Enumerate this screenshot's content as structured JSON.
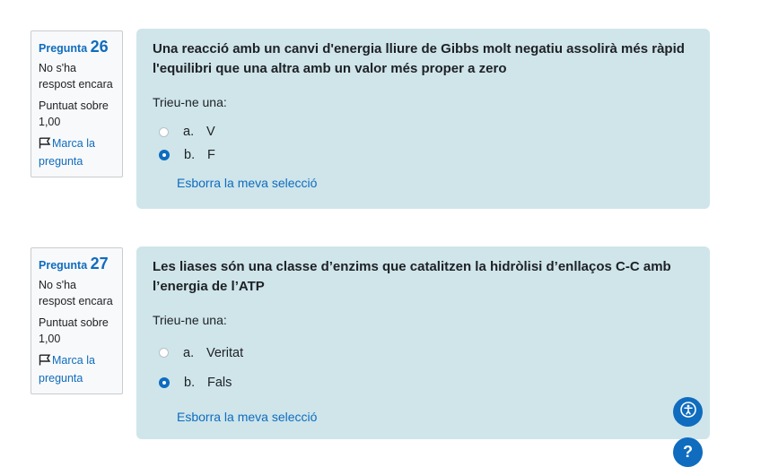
{
  "questions": [
    {
      "label": "Pregunta",
      "number": "26",
      "state": "No s'ha respost encara",
      "grade": "Puntuat sobre 1,00",
      "flag_label": "Marca la pregunta",
      "text": "Una reacció amb un canvi d'energia lliure de Gibbs molt negatiu assolirà més ràpid l'equilibri que una altra amb un valor més proper a zero",
      "prompt": "Trieu-ne una:",
      "options": [
        {
          "letter": "a.",
          "text": "V",
          "selected": false
        },
        {
          "letter": "b.",
          "text": "F",
          "selected": true
        }
      ],
      "clear_label": "Esborra la meva selecció"
    },
    {
      "label": "Pregunta",
      "number": "27",
      "state": "No s'ha respost encara",
      "grade": "Puntuat sobre 1,00",
      "flag_label": "Marca la pregunta",
      "text": "Les liases són una classe d’enzims que catalitzen la hidròlisi d’enllaços C-C amb l’energia de l’ATP",
      "prompt": "Trieu-ne una:",
      "options": [
        {
          "letter": "a.",
          "text": "Veritat",
          "selected": false
        },
        {
          "letter": "b.",
          "text": "Fals",
          "selected": true
        }
      ],
      "clear_label": "Esborra la meva selecció"
    }
  ],
  "floating": {
    "accessibility_icon": "accessibility-icon",
    "help_label": "?"
  },
  "colors": {
    "accent": "#0f6cbf",
    "card_bg": "#cfe5ea",
    "info_bg": "#f8f9fa"
  }
}
